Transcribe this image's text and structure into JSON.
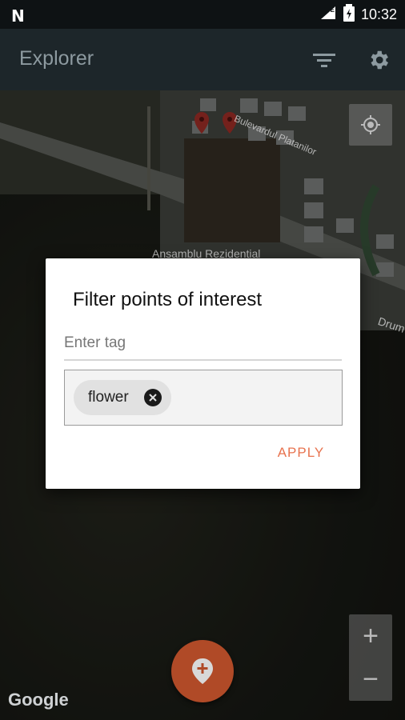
{
  "status_bar": {
    "carrier_logo": "N",
    "network": "LTE",
    "time": "10:32"
  },
  "app_bar": {
    "title": "Explorer"
  },
  "map": {
    "labels": {
      "street": "Bulevardul Platanilor",
      "area": "Ansamblu Rezidential",
      "road": "Drum"
    },
    "attribution": "Google",
    "zoom_in": "+",
    "zoom_out": "−"
  },
  "dialog": {
    "title": "Filter points of interest",
    "input": {
      "placeholder": "Enter tag",
      "value": ""
    },
    "chips": [
      {
        "label": "flower"
      }
    ],
    "apply_label": "APPLY"
  },
  "colors": {
    "accent": "#e8734f",
    "app_bar": "#1d262a",
    "fab": "#b04a27"
  }
}
